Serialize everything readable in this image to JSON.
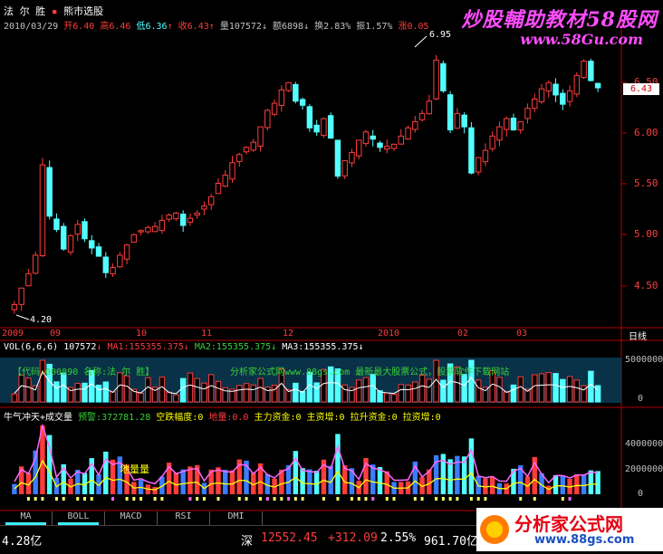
{
  "header": {
    "stock_name": "法 尔 胜",
    "formula_name": "熊市选股",
    "date": "2010/03/29",
    "open_label": "开",
    "open": "6.40",
    "high_label": "高",
    "high": "6.46",
    "low_label": "低",
    "low": "6.36",
    "close_label": "收",
    "close": "6.43",
    "vol_label": "量",
    "vol": "107572",
    "amount_label": "额",
    "amount": "6898",
    "turnover_label": "换",
    "turnover": "2.83%",
    "amplitude_label": "振",
    "amplitude": "1.57%",
    "rise_label": "涨",
    "rise": "0.05"
  },
  "watermark": {
    "title": "炒股輔助教材58股网",
    "url": "www.58Gu.com"
  },
  "price_axis": {
    "ticks": [
      "6.50",
      "6.00",
      "5.50",
      "5.00",
      "4.50"
    ],
    "current_price": "6.43",
    "high_mark": "6.95",
    "low_mark": "4.20"
  },
  "time_axis": {
    "labels": [
      "2009",
      "09",
      "10",
      "11",
      "12",
      "2010",
      "02",
      "03"
    ],
    "period": "日线"
  },
  "volume_panel": {
    "title": "VOL(6,6,6)",
    "value": "107572",
    "ma1_label": "MA1:",
    "ma1": "155355.375",
    "ma2_label": "MA2:",
    "ma2": "155355.375",
    "ma3_label": "MA3:",
    "ma3": "155355.375",
    "axis_top": "5000000",
    "axis_zero": "0",
    "banner": "【代码:000890 名称:法 尔 胜】",
    "banner_ad": "分析家公式网www.88gs.com 最新最大股票公式，股票软件下载网站"
  },
  "indicator_panel": {
    "title": "牛气冲天+成交量",
    "items": [
      {
        "label": "预警:",
        "value": "372781.28",
        "color": "#36d236"
      },
      {
        "label": "空跌幅度:",
        "value": "0",
        "color": "#ffff00"
      },
      {
        "label": "地量:",
        "value": "0.0",
        "color": "#ff3c3c"
      },
      {
        "label": "主力资金:",
        "value": "0",
        "color": "#ffff00"
      },
      {
        "label": "主资增:",
        "value": "0",
        "color": "#ffff00"
      },
      {
        "label": "拉升资金:",
        "value": "0",
        "color": "#ffff00"
      },
      {
        "label": "拉资增:",
        "value": "0",
        "color": "#ffff00"
      }
    ],
    "annotation": "地量量",
    "axis": [
      "4000000",
      "2000000",
      "0"
    ]
  },
  "tabs": [
    "MA",
    "BOLL",
    "MACD",
    "RSI",
    "DMI"
  ],
  "status_bar": {
    "left_value": "4.28亿",
    "market_label": "深",
    "index": "12552.45",
    "change": "+312.09",
    "pct": "2.55%",
    "turnover": "961.70亿"
  },
  "badge": {
    "text": "分析家公式网",
    "url": "www.88gs.com"
  },
  "colors": {
    "up": "#ff3c3c",
    "down": "#54ffff",
    "axis": "#b00000",
    "ma_yellow": "#ffff00",
    "ma_magenta": "#ff66ff",
    "ma_white": "#ffffff"
  },
  "chart_data": {
    "type": "candlestick",
    "x_range": [
      "2009",
      "2010/03/29"
    ],
    "ylim": [
      4.2,
      6.95
    ],
    "close_series": [
      4.32,
      4.48,
      4.62,
      4.8,
      5.68,
      5.18,
      5.05,
      4.86,
      4.99,
      5.1,
      4.96,
      4.87,
      4.79,
      4.63,
      4.68,
      4.8,
      4.9,
      5.0,
      5.04,
      5.07,
      5.08,
      5.14,
      5.19,
      5.21,
      5.09,
      5.16,
      5.21,
      5.28,
      5.37,
      5.5,
      5.58,
      5.7,
      5.78,
      5.85,
      5.9,
      6.05,
      6.21,
      6.28,
      6.41,
      6.48,
      6.3,
      6.26,
      6.04,
      6.0,
      6.13,
      5.94,
      5.57,
      5.72,
      5.8,
      5.92,
      6.0,
      5.93,
      5.85,
      5.86,
      5.88,
      5.96,
      6.04,
      6.1,
      6.18,
      6.3,
      6.7,
      6.4,
      6.02,
      6.18,
      6.05,
      5.6,
      5.75,
      5.82,
      5.96,
      6.05,
      6.13,
      6.02,
      6.1,
      6.23,
      6.32,
      6.42,
      6.48,
      6.36,
      6.27,
      6.4,
      6.55,
      6.69,
      6.5,
      6.43
    ]
  }
}
